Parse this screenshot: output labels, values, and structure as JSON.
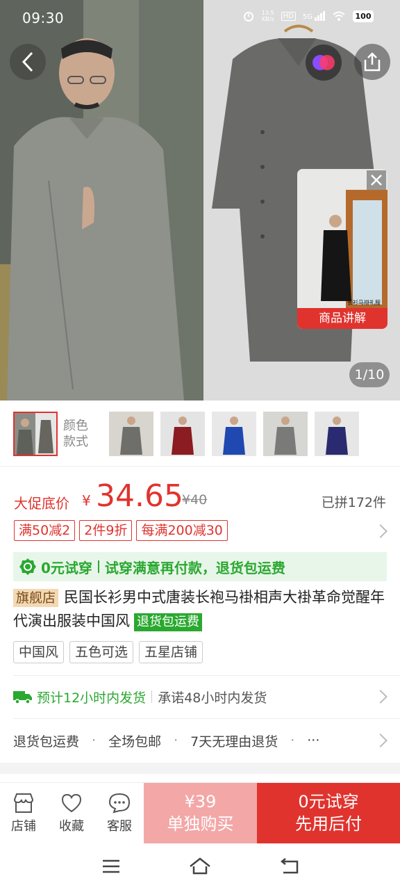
{
  "status_bar": {
    "time": "09:30",
    "network_speed": "13.5",
    "network_unit": "KB/s",
    "hd_label": "HD",
    "signal_label": "5G",
    "battery": "100"
  },
  "gallery": {
    "counter": "1/10",
    "video_label": "商品讲解",
    "video_caption": "长衫马褂礼服"
  },
  "variants": {
    "label_line1": "颜色",
    "label_line2": "款式",
    "thumb_colors": [
      "#6e6e6a",
      "#8a1c22",
      "#1f48b0",
      "#7a7a78",
      "#2a2a70"
    ]
  },
  "price": {
    "prefix": "大促底价",
    "currency": "¥",
    "value": "34.65",
    "original": "¥40",
    "sold": "已拼172件"
  },
  "coupons": [
    "满50减2",
    "2件9折",
    "每满200减30"
  ],
  "trial_banner": {
    "label": "0元试穿",
    "text": "试穿满意再付款，退货包运费"
  },
  "product": {
    "badge": "旗舰店",
    "title": "民国长衫男中式唐装长袍马褂相声大褂革命觉醒年代演出服装中国风",
    "badge_green": "退货包运费"
  },
  "tags": [
    "中国风",
    "五色可选",
    "五星店铺"
  ],
  "shipping": {
    "estimate": "预计12小时内发货",
    "promise": "承诺48小时内发货"
  },
  "services": [
    "退货包运费",
    "全场包邮",
    "7天无理由退货"
  ],
  "services_more": "···",
  "bottom_bar": {
    "store": "店铺",
    "favorite": "收藏",
    "service": "客服",
    "solo_price": "¥39",
    "solo_label": "单独购买",
    "trial_line1": "0元试穿",
    "trial_line2": "先用后付"
  },
  "colors": {
    "accent_red": "#e0332e",
    "green": "#2aa830",
    "solo_pink": "#f3a7a7"
  }
}
